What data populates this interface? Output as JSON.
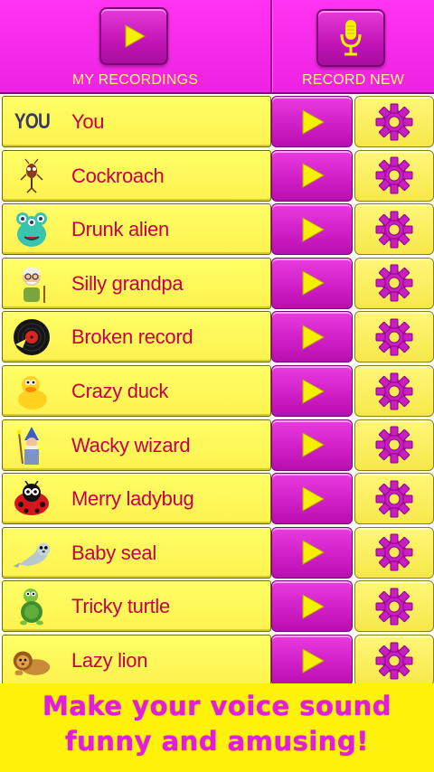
{
  "header": {
    "my_recordings_label": "MY RECORDINGS",
    "record_new_label": "RECORD NEW"
  },
  "voices": [
    {
      "name": "You",
      "icon": "you-text-icon",
      "icon_text": "YOU"
    },
    {
      "name": "Cockroach",
      "icon": "cockroach-icon"
    },
    {
      "name": "Drunk alien",
      "icon": "alien-icon"
    },
    {
      "name": "Silly grandpa",
      "icon": "grandpa-icon"
    },
    {
      "name": "Broken record",
      "icon": "vinyl-record-icon"
    },
    {
      "name": "Crazy duck",
      "icon": "duck-icon"
    },
    {
      "name": "Wacky wizard",
      "icon": "wizard-icon"
    },
    {
      "name": "Merry ladybug",
      "icon": "ladybug-icon"
    },
    {
      "name": "Baby seal",
      "icon": "seal-icon"
    },
    {
      "name": "Tricky turtle",
      "icon": "turtle-icon"
    },
    {
      "name": "Lazy lion",
      "icon": "lion-icon"
    }
  ],
  "footer": {
    "line1": "Make your voice sound",
    "line2": "funny and amusing!"
  },
  "colors": {
    "magenta": "#e021d6",
    "yellow": "#fdf24f",
    "name_text": "#c8004a",
    "play_triangle": "#f4f000",
    "gear": "#c71fc0"
  }
}
